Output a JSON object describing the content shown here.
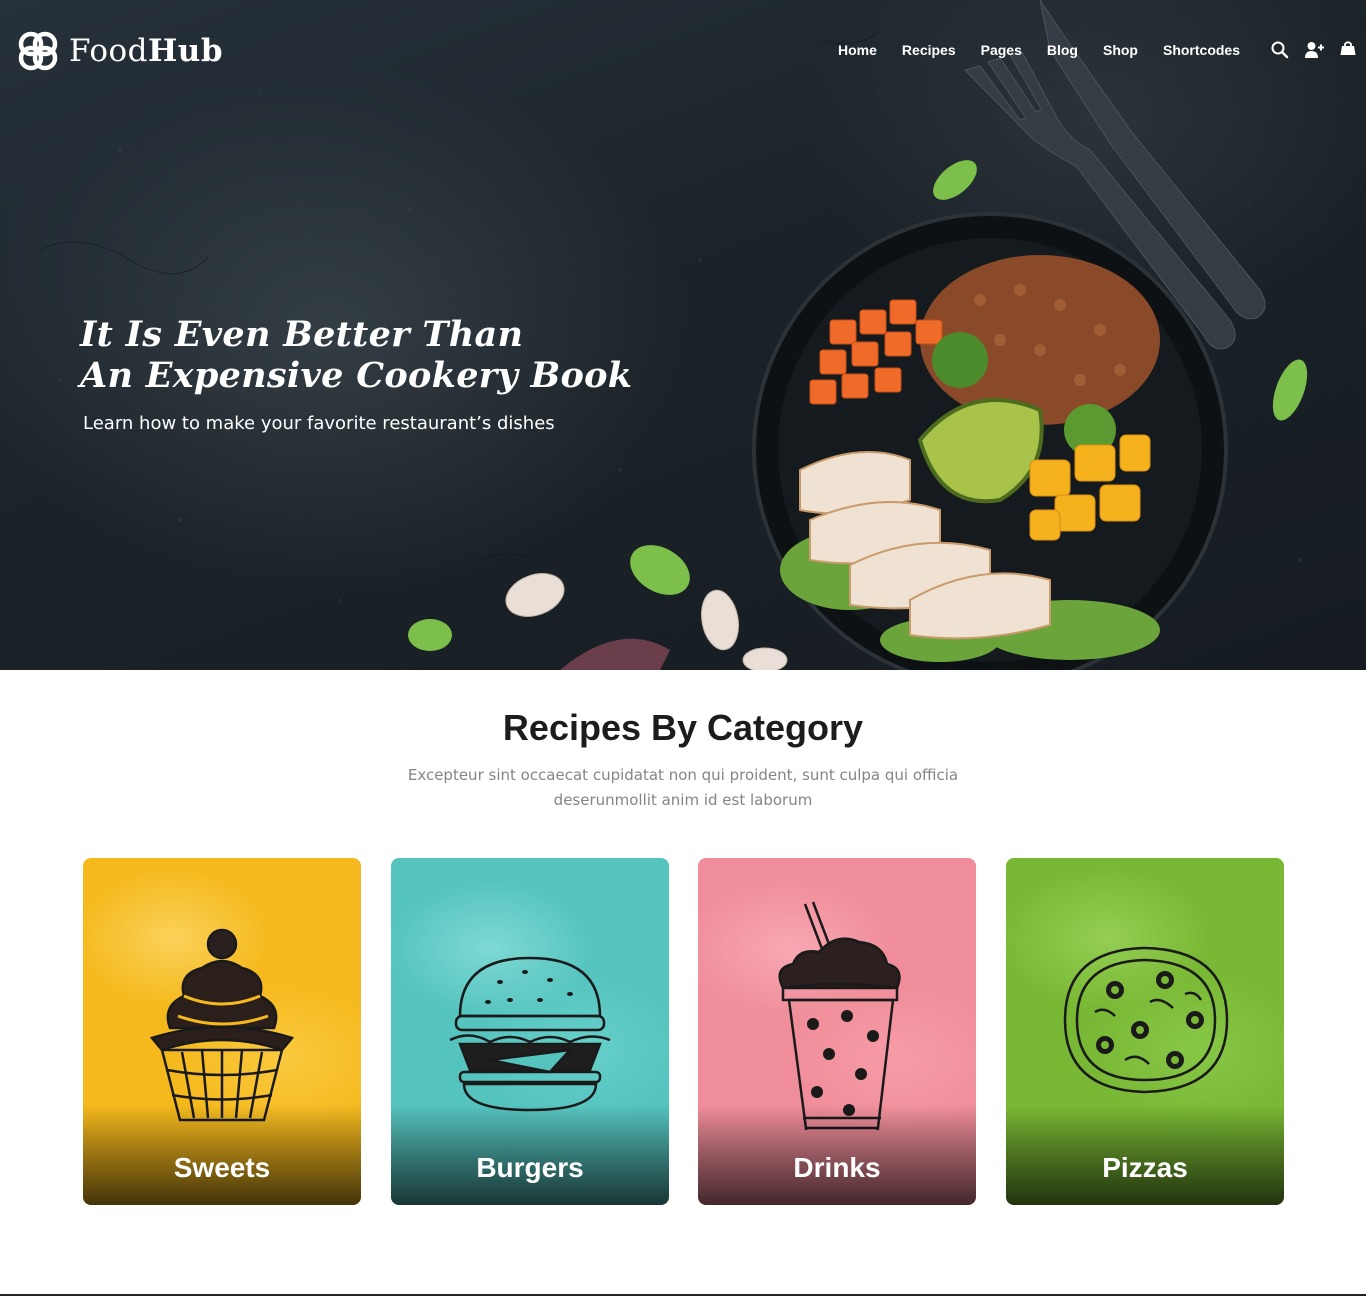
{
  "header": {
    "logo_light": "Food",
    "logo_bold": "Hub",
    "nav": [
      "Home",
      "Recipes",
      "Pages",
      "Blog",
      "Shop",
      "Shortcodes"
    ],
    "icons": [
      "search-icon",
      "add-user-icon",
      "cart-icon"
    ]
  },
  "hero": {
    "title_line1": "It Is Even Better Than",
    "title_line2": "An Expensive Cookery Book",
    "subtitle": "Learn how to make your favorite restaurant’s dishes"
  },
  "categories": {
    "title": "Recipes By Category",
    "description": "Excepteur sint occaecat cupidatat non qui proident, sunt culpa qui officia deserunmollit anim id est laborum",
    "items": [
      {
        "label": "Sweets",
        "color": "#f7c22a",
        "icon": "cupcake-icon"
      },
      {
        "label": "Burgers",
        "color": "#5ccbc6",
        "icon": "burger-icon"
      },
      {
        "label": "Drinks",
        "color": "#f3909d",
        "icon": "milkshake-icon"
      },
      {
        "label": "Pizzas",
        "color": "#7fbf3a",
        "icon": "pizza-icon"
      }
    ]
  }
}
